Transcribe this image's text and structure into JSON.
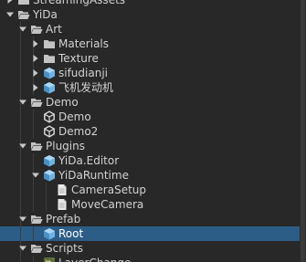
{
  "tree": {
    "items": [
      {
        "label": "StreamingAssets",
        "icon": "folder-icon",
        "expanded": false
      },
      {
        "label": "YiDa",
        "icon": "folder-open-icon",
        "expanded": true
      },
      {
        "label": "Art",
        "icon": "folder-open-icon",
        "expanded": true
      },
      {
        "label": "Materials",
        "icon": "folder-icon",
        "expanded": false
      },
      {
        "label": "Texture",
        "icon": "folder-icon",
        "expanded": false
      },
      {
        "label": "sifudianji",
        "icon": "prefab-cube-icon",
        "expanded": false
      },
      {
        "label": "飞机发动机",
        "icon": "prefab-cube-icon",
        "expanded": false
      },
      {
        "label": "Demo",
        "icon": "folder-open-icon",
        "expanded": true
      },
      {
        "label": "Demo",
        "icon": "unity-scene-icon"
      },
      {
        "label": "Demo2",
        "icon": "unity-scene-icon"
      },
      {
        "label": "Plugins",
        "icon": "folder-open-icon",
        "expanded": true
      },
      {
        "label": "YiDa.Editor",
        "icon": "assembly-definition-icon"
      },
      {
        "label": "YiDaRuntime",
        "icon": "prefab-cube-icon",
        "expanded": true
      },
      {
        "label": "CameraSetup",
        "icon": "script-file-icon"
      },
      {
        "label": "MoveCamera",
        "icon": "script-file-icon"
      },
      {
        "label": "Prefab",
        "icon": "folder-open-icon",
        "expanded": true
      },
      {
        "label": "Root",
        "icon": "prefab-cube-icon",
        "selected": true
      },
      {
        "label": "Scripts",
        "icon": "folder-open-icon",
        "expanded": true
      },
      {
        "label": "LayerChange",
        "icon": "csharp-script-icon"
      }
    ]
  },
  "colors": {
    "background": "#282828",
    "selection": "#2c5d87",
    "folder": "#c3c3c3",
    "prefab": "#6fb3e4",
    "text": "#d2d2d2"
  }
}
